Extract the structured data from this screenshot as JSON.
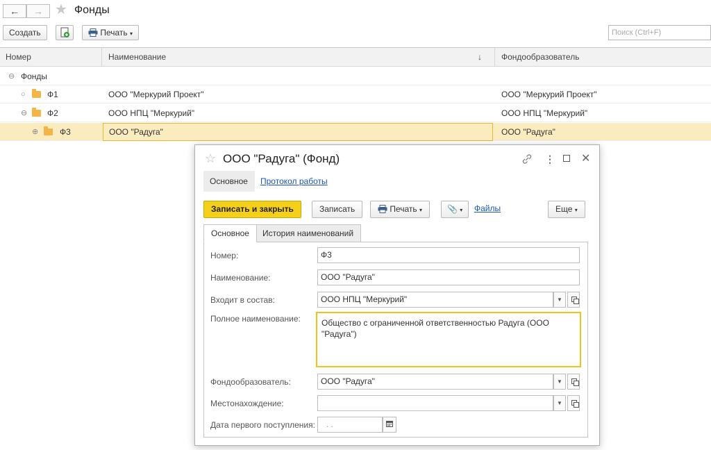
{
  "window": {
    "title": "Фонды",
    "back_icon": "←",
    "forward_icon": "→",
    "star_icon": "★"
  },
  "toolbar": {
    "create_label": "Создать",
    "print_label": "Печать",
    "search_placeholder": "Поиск (Ctrl+F)"
  },
  "list": {
    "columns": {
      "number": "Номер",
      "name": "Наименование",
      "sort_indicator": "↓",
      "founder": "Фондообразователь"
    },
    "root_label": "Фонды",
    "rows": [
      {
        "number": "Ф1",
        "name": "ООО \"Меркурий Проект\"",
        "founder": "ООО \"Меркурий Проект\""
      },
      {
        "number": "Ф2",
        "name": "ООО НПЦ \"Меркурий\"",
        "founder": "ООО НПЦ \"Меркурий\""
      },
      {
        "number": "Ф3",
        "name": "ООО \"Радуга\"",
        "founder": "ООО \"Радуга\""
      }
    ]
  },
  "dialog": {
    "title": "ООО \"Радуга\" (Фонд)",
    "nav": {
      "main": "Основное",
      "log": "Протокол работы"
    },
    "buttons": {
      "save_close": "Записать и закрыть",
      "save": "Записать",
      "print": "Печать",
      "files": "Файлы",
      "more": "Еще"
    },
    "tabs": {
      "main": "Основное",
      "history": "История наименований"
    },
    "fields": {
      "number_label": "Номер:",
      "number_value": "Ф3",
      "name_label": "Наименование:",
      "name_value": "ООО \"Радуга\"",
      "parent_label": "Входит в состав:",
      "parent_value": "ООО НПЦ \"Меркурий\"",
      "fullname_label": "Полное наименование:",
      "fullname_value": "Общество с ограниченной ответственностью Радуга (ООО \"Радуга\")",
      "founder_label": "Фондообразователь:",
      "founder_value": "ООО \"Радуга\"",
      "location_label": "Местонахождение:",
      "location_value": "",
      "date_label": "Дата первого поступления:",
      "date_value": ". ."
    }
  },
  "colors": {
    "accent_yellow": "#f4d01a",
    "selected_row": "#fbecc0",
    "link": "#1a56b5",
    "folder": "#f3b547"
  }
}
